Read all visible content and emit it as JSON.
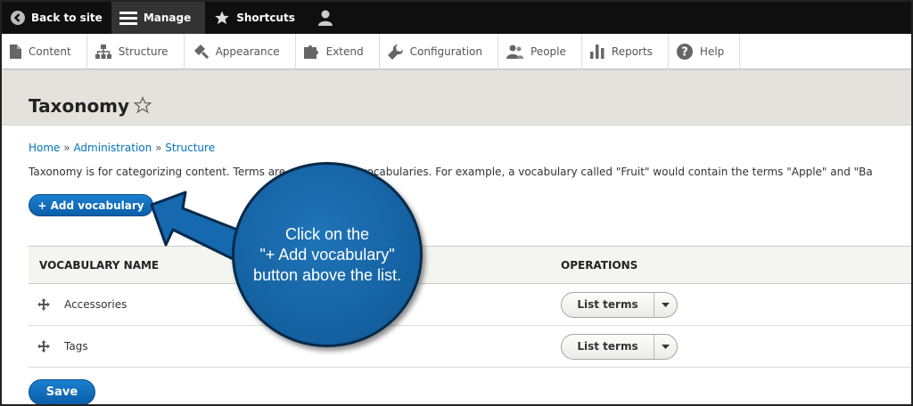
{
  "toolbar": {
    "back_label": "Back to site",
    "manage_label": "Manage",
    "shortcuts_label": "Shortcuts"
  },
  "tray": [
    {
      "label": "Content",
      "icon": "file-icon"
    },
    {
      "label": "Structure",
      "icon": "sitemap-icon"
    },
    {
      "label": "Appearance",
      "icon": "paint-icon"
    },
    {
      "label": "Extend",
      "icon": "puzzle-icon"
    },
    {
      "label": "Configuration",
      "icon": "wrench-icon"
    },
    {
      "label": "People",
      "icon": "people-icon"
    },
    {
      "label": "Reports",
      "icon": "bar-chart-icon"
    },
    {
      "label": "Help",
      "icon": "help-icon"
    }
  ],
  "page": {
    "title": "Taxonomy",
    "breadcrumb": [
      "Home",
      "Administration",
      "Structure"
    ],
    "breadcrumb_sep": "»",
    "description": "Taxonomy is for categorizing content. Terms are grouped into vocabularies. For example, a vocabulary called \"Fruit\" would contain the terms \"Apple\" and \"Ba"
  },
  "actions": {
    "add_vocabulary": "+ Add vocabulary",
    "save": "Save"
  },
  "table": {
    "headers": [
      "VOCABULARY NAME",
      "OPERATIONS"
    ],
    "rows": [
      {
        "name": "Accessories",
        "operation": "List terms"
      },
      {
        "name": "Tags",
        "operation": "List terms"
      }
    ]
  },
  "callout": {
    "lines": [
      "Click on the",
      "\"+ Add vocabulary\"",
      "button above the list."
    ]
  },
  "colors": {
    "accent_blue": "#0b5ea8",
    "toolbar_bg": "#0f0f0f",
    "header_bg": "#e3e2dc",
    "callout_blue": "#1a68a8"
  }
}
